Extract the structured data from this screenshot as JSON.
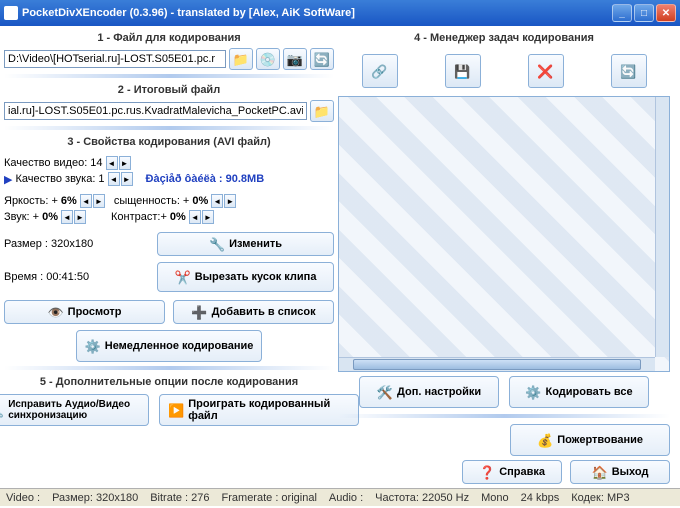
{
  "window": {
    "title": "PocketDivXEncoder (0.3.96) - translated by [Alex, AiK SoftWare]"
  },
  "section1": {
    "title": "1 - Файл для кодирования",
    "input_value": "D:\\Video\\[HOTserial.ru]-LOST.S05E01.pc.r"
  },
  "section2": {
    "title": "2 - Итоговый файл",
    "input_value": "ial.ru]-LOST.S05E01.pc.rus.KvadratMalevicha_PocketPC.avi"
  },
  "section3": {
    "title": "3 - Свойства кодирования (AVI файл)",
    "video_q_label": "Качество видео:",
    "video_q_value": "14",
    "audio_q_label": "Качество звука:",
    "audio_q_value": "1",
    "size_est_label": "Ðàçìåð ôàéëà : 90.8MB",
    "brightness_label": "Яркость: +",
    "brightness_value": "6%",
    "saturation_label": "сыщенность: +",
    "saturation_value": "0%",
    "sound_label": "Звук: +",
    "sound_value": "0%",
    "contrast_label": "Контраст:+",
    "contrast_value": "0%",
    "dimensions_label": "Размер : 320x180",
    "change_btn": "Изменить",
    "time_label": "Время : 00:41:50",
    "cut_btn": "Вырезать кусок клипа",
    "preview_btn": "Просмотр",
    "add_btn": "Добавить в список",
    "immediate_btn": "Немедленное кодирование"
  },
  "section4": {
    "title": "4 - Менеджер задач кодирования",
    "extra_btn": "Доп. настройки",
    "encode_all_btn": "Кодировать все"
  },
  "section5": {
    "title": "5 - Дополнительные опции после кодирования",
    "fix_av_btn": "Исправить Аудио/Видео синхронизацию",
    "play_btn": "Проиграть кодированный файл",
    "donate_btn": "Пожертвование",
    "help_btn": "Справка",
    "exit_btn": "Выход"
  },
  "status": {
    "video": "Video :",
    "size": "Размер: 320x180",
    "bitrate": "Bitrate : 276",
    "framerate": "Framerate : original",
    "audio": "Audio :",
    "freq": "Частота: 22050 Hz",
    "mono": "Mono",
    "kbps": "24 kbps",
    "codec": "Кодек: MP3"
  }
}
